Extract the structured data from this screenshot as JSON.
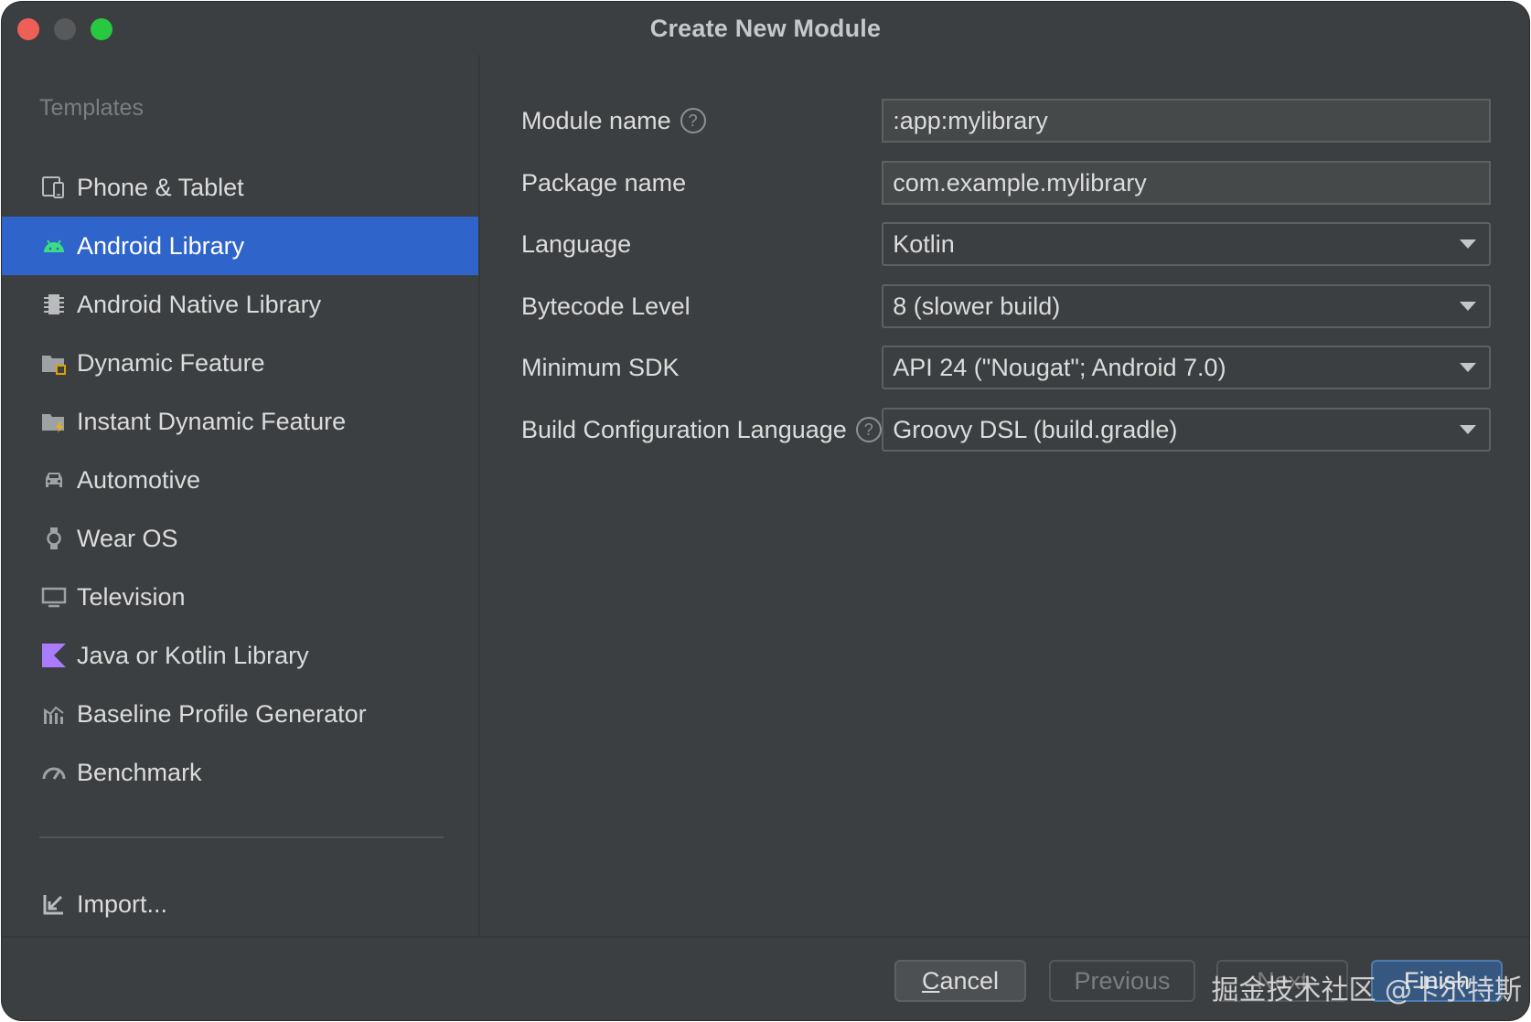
{
  "window": {
    "title": "Create New Module"
  },
  "sidebar": {
    "section_label": "Templates",
    "items": [
      {
        "label": "Phone & Tablet",
        "icon": "phone-tablet-icon"
      },
      {
        "label": "Android Library",
        "icon": "android-icon",
        "selected": true
      },
      {
        "label": "Android Native Library",
        "icon": "chip-icon"
      },
      {
        "label": "Dynamic Feature",
        "icon": "folder-icon"
      },
      {
        "label": "Instant Dynamic Feature",
        "icon": "folder-lightning-icon"
      },
      {
        "label": "Automotive",
        "icon": "car-icon"
      },
      {
        "label": "Wear OS",
        "icon": "watch-icon"
      },
      {
        "label": "Television",
        "icon": "tv-icon"
      },
      {
        "label": "Java or Kotlin Library",
        "icon": "kotlin-icon"
      },
      {
        "label": "Baseline Profile Generator",
        "icon": "chart-icon"
      },
      {
        "label": "Benchmark",
        "icon": "gauge-icon"
      }
    ],
    "import_label": "Import..."
  },
  "form": {
    "module_name": {
      "label": "Module name",
      "value": ":app:mylibrary"
    },
    "package_name": {
      "label": "Package name",
      "value": "com.example.mylibrary"
    },
    "language": {
      "label": "Language",
      "value": "Kotlin"
    },
    "bytecode_level": {
      "label": "Bytecode Level",
      "value": "8 (slower build)"
    },
    "minimum_sdk": {
      "label": "Minimum SDK",
      "value": "API 24 (\"Nougat\"; Android 7.0)"
    },
    "build_config_language": {
      "label": "Build Configuration Language",
      "value": "Groovy DSL (build.gradle)"
    }
  },
  "footer": {
    "cancel_label_mnemonic": "C",
    "cancel_label_rest": "ancel",
    "previous_label": "Previous",
    "next_label": "Next",
    "finish_label": "Finish"
  },
  "watermark": "掘金技术社区 @卡尔特斯",
  "colors": {
    "background": "#3c3f41",
    "selection": "#2f65ca",
    "android_green": "#3ddc84",
    "kotlin_purple": "#a97bff",
    "finish_button": "#365880"
  }
}
